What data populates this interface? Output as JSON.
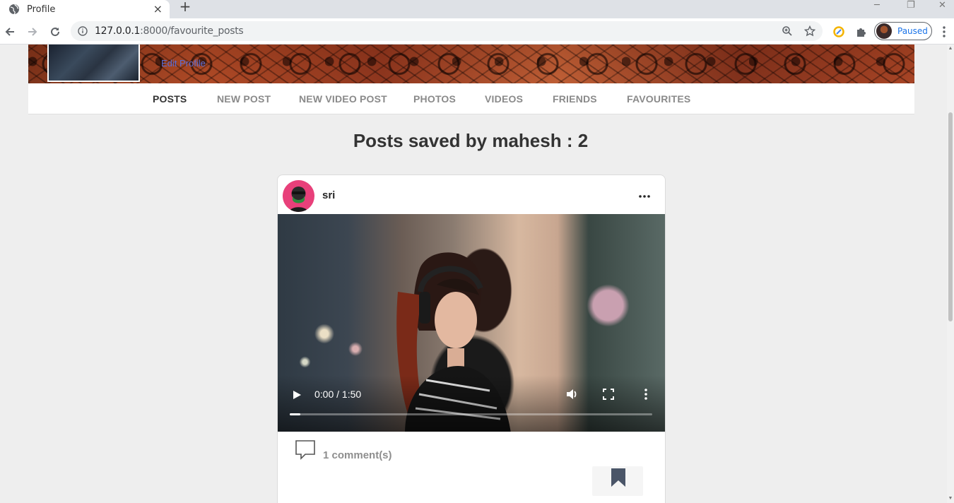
{
  "browser": {
    "tab_title": "Profile",
    "tab_close": "×",
    "new_tab": "+",
    "url_host": "127.0.0.1",
    "url_rest": ":8000/favourite_posts",
    "profile_status": "Paused",
    "window_controls": [
      "─",
      "❐",
      "✕"
    ]
  },
  "profile": {
    "edit_label": "Edit Profile"
  },
  "nav_tabs": [
    {
      "label": "POSTS",
      "active": true
    },
    {
      "label": "NEW POST",
      "active": false
    },
    {
      "label": "NEW VIDEO POST",
      "active": false
    },
    {
      "label": "PHOTOS",
      "active": false
    },
    {
      "label": "VIDEOS",
      "active": false
    },
    {
      "label": "FRIENDS",
      "active": false
    },
    {
      "label": "FAVOURITES",
      "active": false
    }
  ],
  "heading": "Posts saved by mahesh : 2",
  "post": {
    "author": "sri",
    "video": {
      "time": "0:00 / 1:50",
      "progress": 0.03
    },
    "comments": "1 comment(s)",
    "saved": true
  },
  "colors": {
    "accent_link": "#5b6ed6",
    "avatar_bg": "#e8407a",
    "profile_status": "#1a73e8"
  },
  "icons": [
    "globe-icon",
    "back-icon",
    "forward-icon",
    "reload-icon",
    "info-icon",
    "zoom-icon",
    "star-icon",
    "extension-icon",
    "puzzle-icon",
    "menu-icon",
    "more-icon",
    "play-icon",
    "volume-icon",
    "fullscreen-icon",
    "comment-icon",
    "bookmark-icon"
  ]
}
